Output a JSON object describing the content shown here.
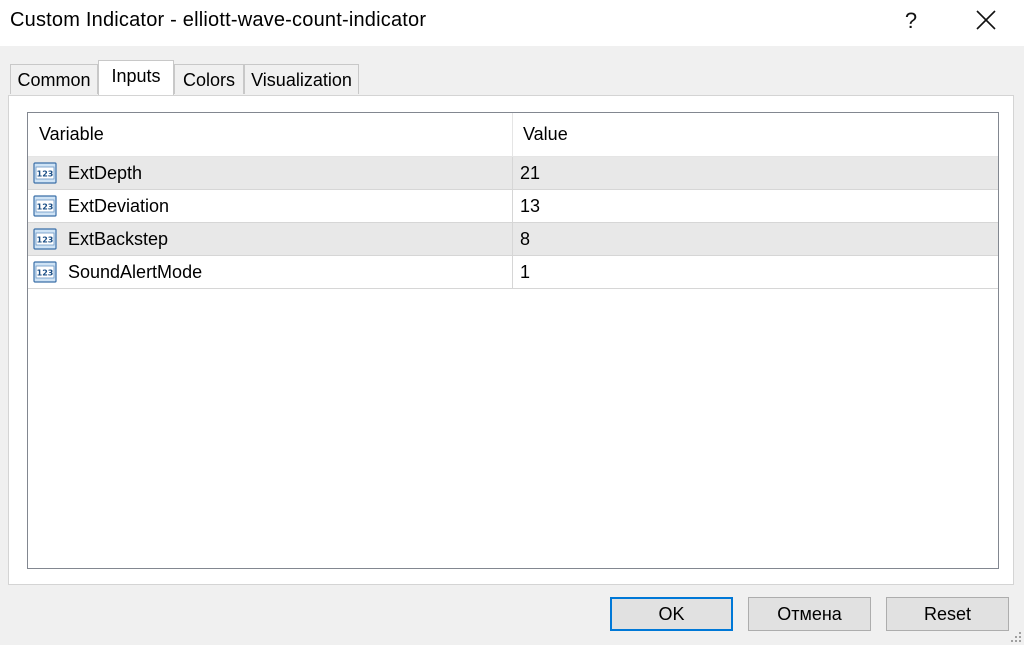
{
  "window": {
    "title": "Custom Indicator - elliott-wave-count-indicator",
    "help_label": "?",
    "close_icon": "close-icon"
  },
  "tabs": [
    {
      "label": "Common",
      "active": false
    },
    {
      "label": "Inputs",
      "active": true
    },
    {
      "label": "Colors",
      "active": false
    },
    {
      "label": "Visualization",
      "active": false
    }
  ],
  "table": {
    "columns": [
      "Variable",
      "Value"
    ],
    "rows": [
      {
        "icon": "integer-type-icon",
        "icon_text": "123",
        "variable": "ExtDepth",
        "value": "21"
      },
      {
        "icon": "integer-type-icon",
        "icon_text": "123",
        "variable": "ExtDeviation",
        "value": "13"
      },
      {
        "icon": "integer-type-icon",
        "icon_text": "123",
        "variable": "ExtBackstep",
        "value": "8"
      },
      {
        "icon": "integer-type-icon",
        "icon_text": "123",
        "variable": "SoundAlertMode",
        "value": "1"
      }
    ]
  },
  "buttons": {
    "ok": "OK",
    "cancel": "Отмена",
    "reset": "Reset"
  },
  "colors": {
    "default_button_border": "#0078d7",
    "row_alt": "#e8e8e8"
  }
}
